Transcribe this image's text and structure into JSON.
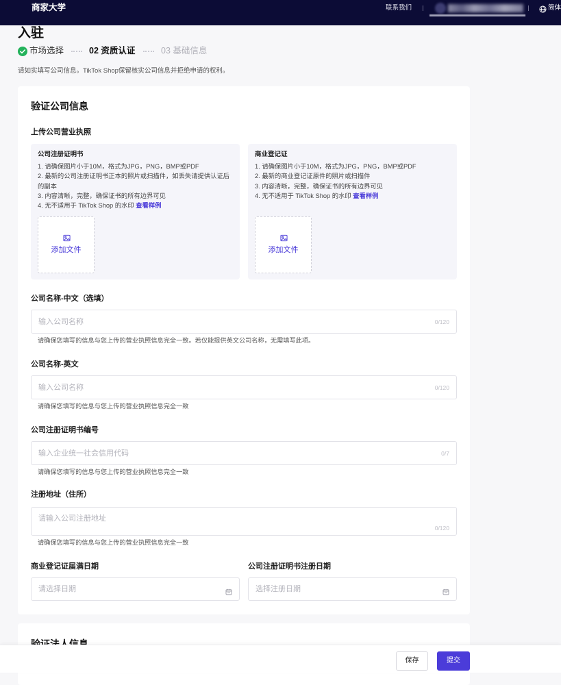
{
  "topbar": {
    "brand": "商家大学",
    "contact_label": "联系我们",
    "language_label": "简体"
  },
  "page": {
    "title": "入驻",
    "notice": "请如实填写公司信息。TikTok Shop保留核实公司信息并拒绝申请的权利。"
  },
  "steps": [
    {
      "label": "市场选择",
      "status": "completed"
    },
    {
      "label": "02 资质认证",
      "status": "current"
    },
    {
      "label": "03 基础信息",
      "status": "upcoming"
    }
  ],
  "company_section": {
    "title": "验证公司信息",
    "upload_label": "上传公司营业执照",
    "uploads": [
      {
        "title": "公司注册证明书",
        "rules": [
          "1. 请确保图片小于10M，格式为JPG，PNG，BMP或PDF",
          "2. 最新的公司注册证明书正本的照片或扫描件，如丢失请提供认证后的副本",
          "3. 内容清晰，完整，确保证书的所有边界可见"
        ],
        "last_rule": "4. 无不适用于 TikTok Shop 的水印 ",
        "example_link": "查看样例",
        "add_file_label": "添加文件"
      },
      {
        "title": "商业登记证",
        "rules": [
          "1. 请确保图片小于10M，格式为JPG，PNG，BMP或PDF",
          "2. 最新的商业登记证原件的照片或扫描件",
          "3. 内容清晰，完整，确保证书的所有边界可见"
        ],
        "last_rule": "4. 无不适用于 TikTok Shop 的水印 ",
        "example_link": "查看样例",
        "add_file_label": "添加文件"
      }
    ],
    "fields": {
      "name_cn": {
        "label": "公司名称-中文（选填）",
        "value": "",
        "placeholder": "输入公司名称",
        "counter": "0/120",
        "help": "请确保您填写的信息与您上传的营业执照信息完全一致。若仅能提供英文公司名称，无需填写此项。"
      },
      "name_en": {
        "label": "公司名称-英文",
        "value": "",
        "placeholder": "输入公司名称",
        "counter": "0/120",
        "help": "请确保您填写的信息与您上传的营业执照信息完全一致"
      },
      "reg_number": {
        "label": "公司注册证明书编号",
        "value": "",
        "placeholder": "输入企业统一社会信用代码",
        "counter": "0/7",
        "help": "请确保您填写的信息与您上传的营业执照信息完全一致"
      },
      "address": {
        "label": "注册地址（住所）",
        "value": "",
        "placeholder": "请输入公司注册地址",
        "counter": "0/120",
        "help": "请确保您填写的信息与您上传的营业执照信息完全一致"
      },
      "expiry_date": {
        "label": "商业登记证届满日期",
        "value": "",
        "placeholder": "请选择日期"
      },
      "registration_date": {
        "label": "公司注册证明书注册日期",
        "value": "",
        "placeholder": "选择注册日期"
      }
    }
  },
  "legal_rep_section": {
    "title": "验证法人信息"
  },
  "footer": {
    "save_label": "保存",
    "submit_label": "提交"
  },
  "icons": {
    "language": "globe-icon",
    "step_completed": "check-circle-icon",
    "upload": "image-icon",
    "date_picker": "calendar-icon"
  },
  "colors": {
    "topbar": "#0c0c36",
    "accent": "#4b3cd9",
    "success": "#23b25b",
    "panel_background": "#f5f5fa"
  }
}
